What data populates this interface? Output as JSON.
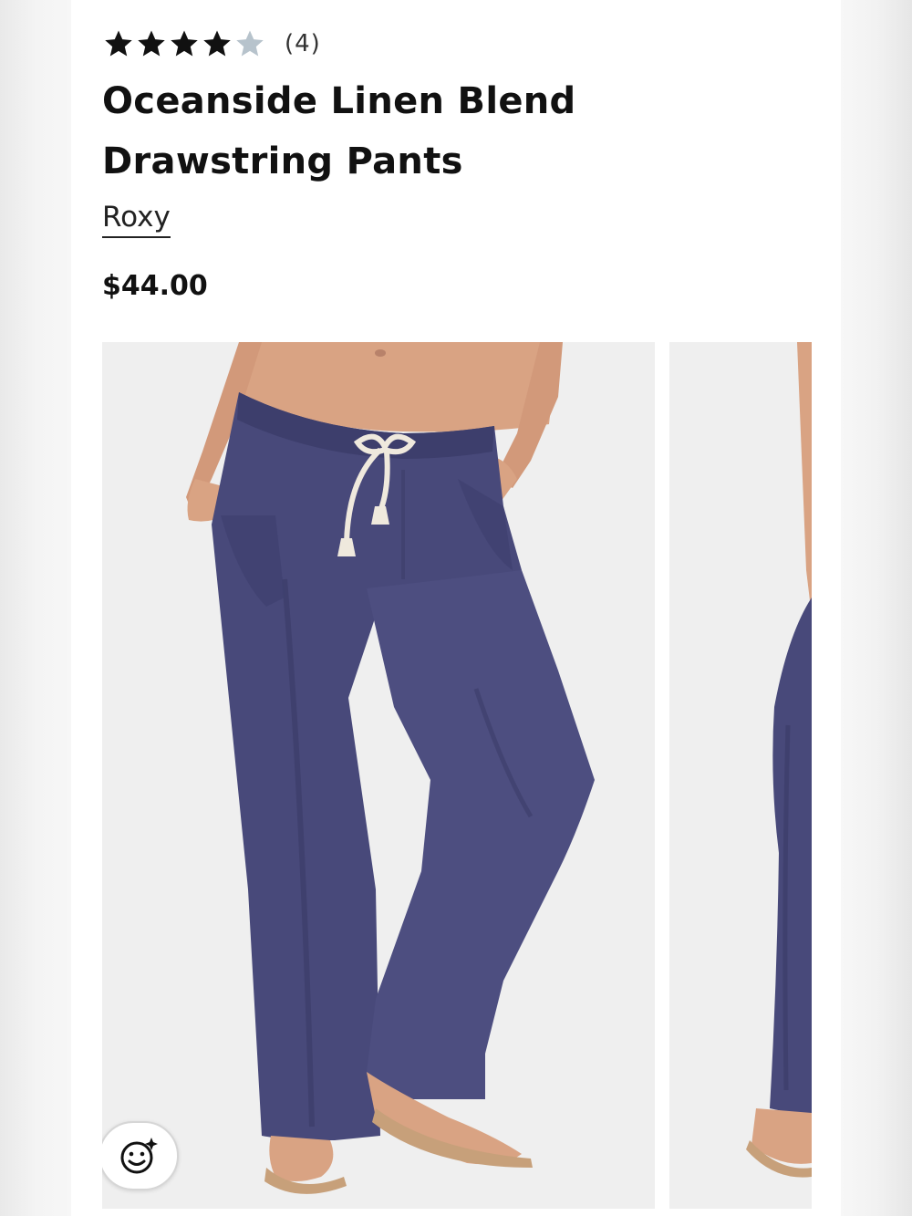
{
  "product": {
    "rating": 4,
    "rating_max": 5,
    "review_count": "(4)",
    "title": "Oceanside Linen Blend Drawstring Pants",
    "brand": "Roxy",
    "price": "$44.00"
  },
  "colors": {
    "star_filled": "#111111",
    "star_empty": "#b7c3cc",
    "pants": "#48497a",
    "pants_shadow": "#3a3b66",
    "skin": "#d9a383",
    "drawstring": "#efe9dd",
    "sandal": "#c7a07a"
  },
  "gallery": {
    "images": [
      "product-photo-front",
      "product-photo-side"
    ]
  },
  "icons": {
    "rating_star": "star-icon",
    "ar_button": "face-sparkle-icon"
  }
}
